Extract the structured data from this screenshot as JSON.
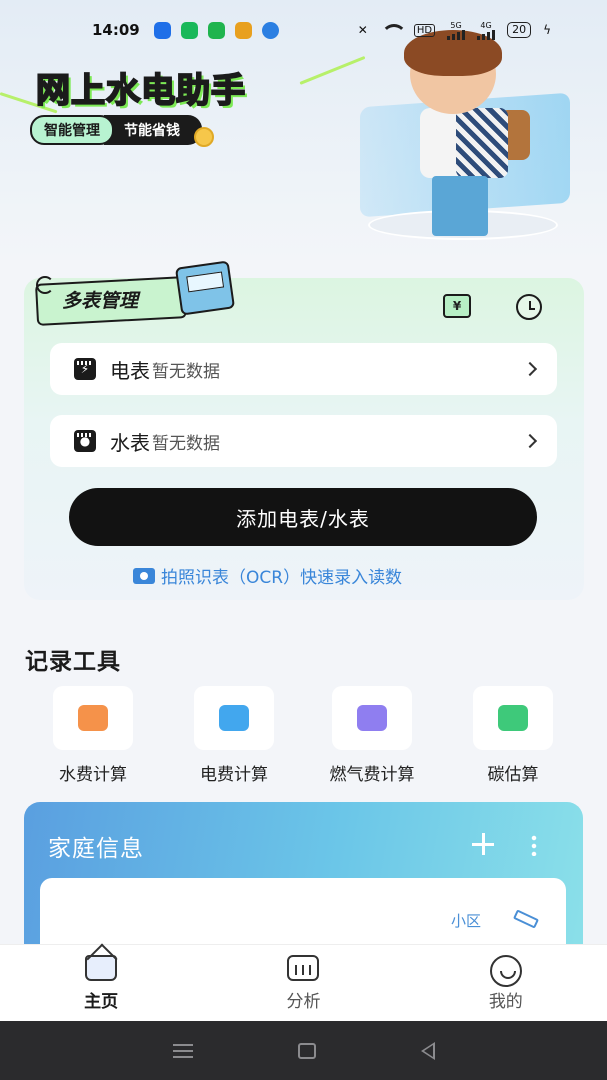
{
  "status_bar": {
    "time": "14:09",
    "network_label": "HD",
    "battery": "20",
    "signal_5g": "5G",
    "signal_4g": "4G",
    "app_icon_colors": [
      "#1f6fe8",
      "#19b85a",
      "#1fb44e",
      "#e8a01f",
      "#2b7fe2"
    ]
  },
  "hero": {
    "title": "网上水电助手",
    "tag_primary": "智能管理",
    "tag_secondary": "节能省钱"
  },
  "meter_card": {
    "badge": "多表管理",
    "yen_icon": "¥",
    "rows": [
      {
        "title": "电表",
        "subtitle": "暂无数据",
        "icon": "electric-meter-icon"
      },
      {
        "title": "水表",
        "subtitle": "暂无数据",
        "icon": "water-meter-icon"
      }
    ],
    "add_button": "添加电表/水表",
    "ocr_hint": "拍照识表（OCR）快速录入读数"
  },
  "tools": {
    "title": "记录工具",
    "items": [
      {
        "label": "水费计算",
        "color": "#f5924a"
      },
      {
        "label": "电费计算",
        "color": "#42a7ee"
      },
      {
        "label": "燃气费计算",
        "color": "#8f7ef0"
      },
      {
        "label": "碳估算",
        "color": "#3ec97a"
      }
    ]
  },
  "family": {
    "title": "家庭信息",
    "community_label": "小区"
  },
  "nav": {
    "items": [
      {
        "label": "主页",
        "active": true
      },
      {
        "label": "分析",
        "active": false
      },
      {
        "label": "我的",
        "active": false
      }
    ]
  }
}
